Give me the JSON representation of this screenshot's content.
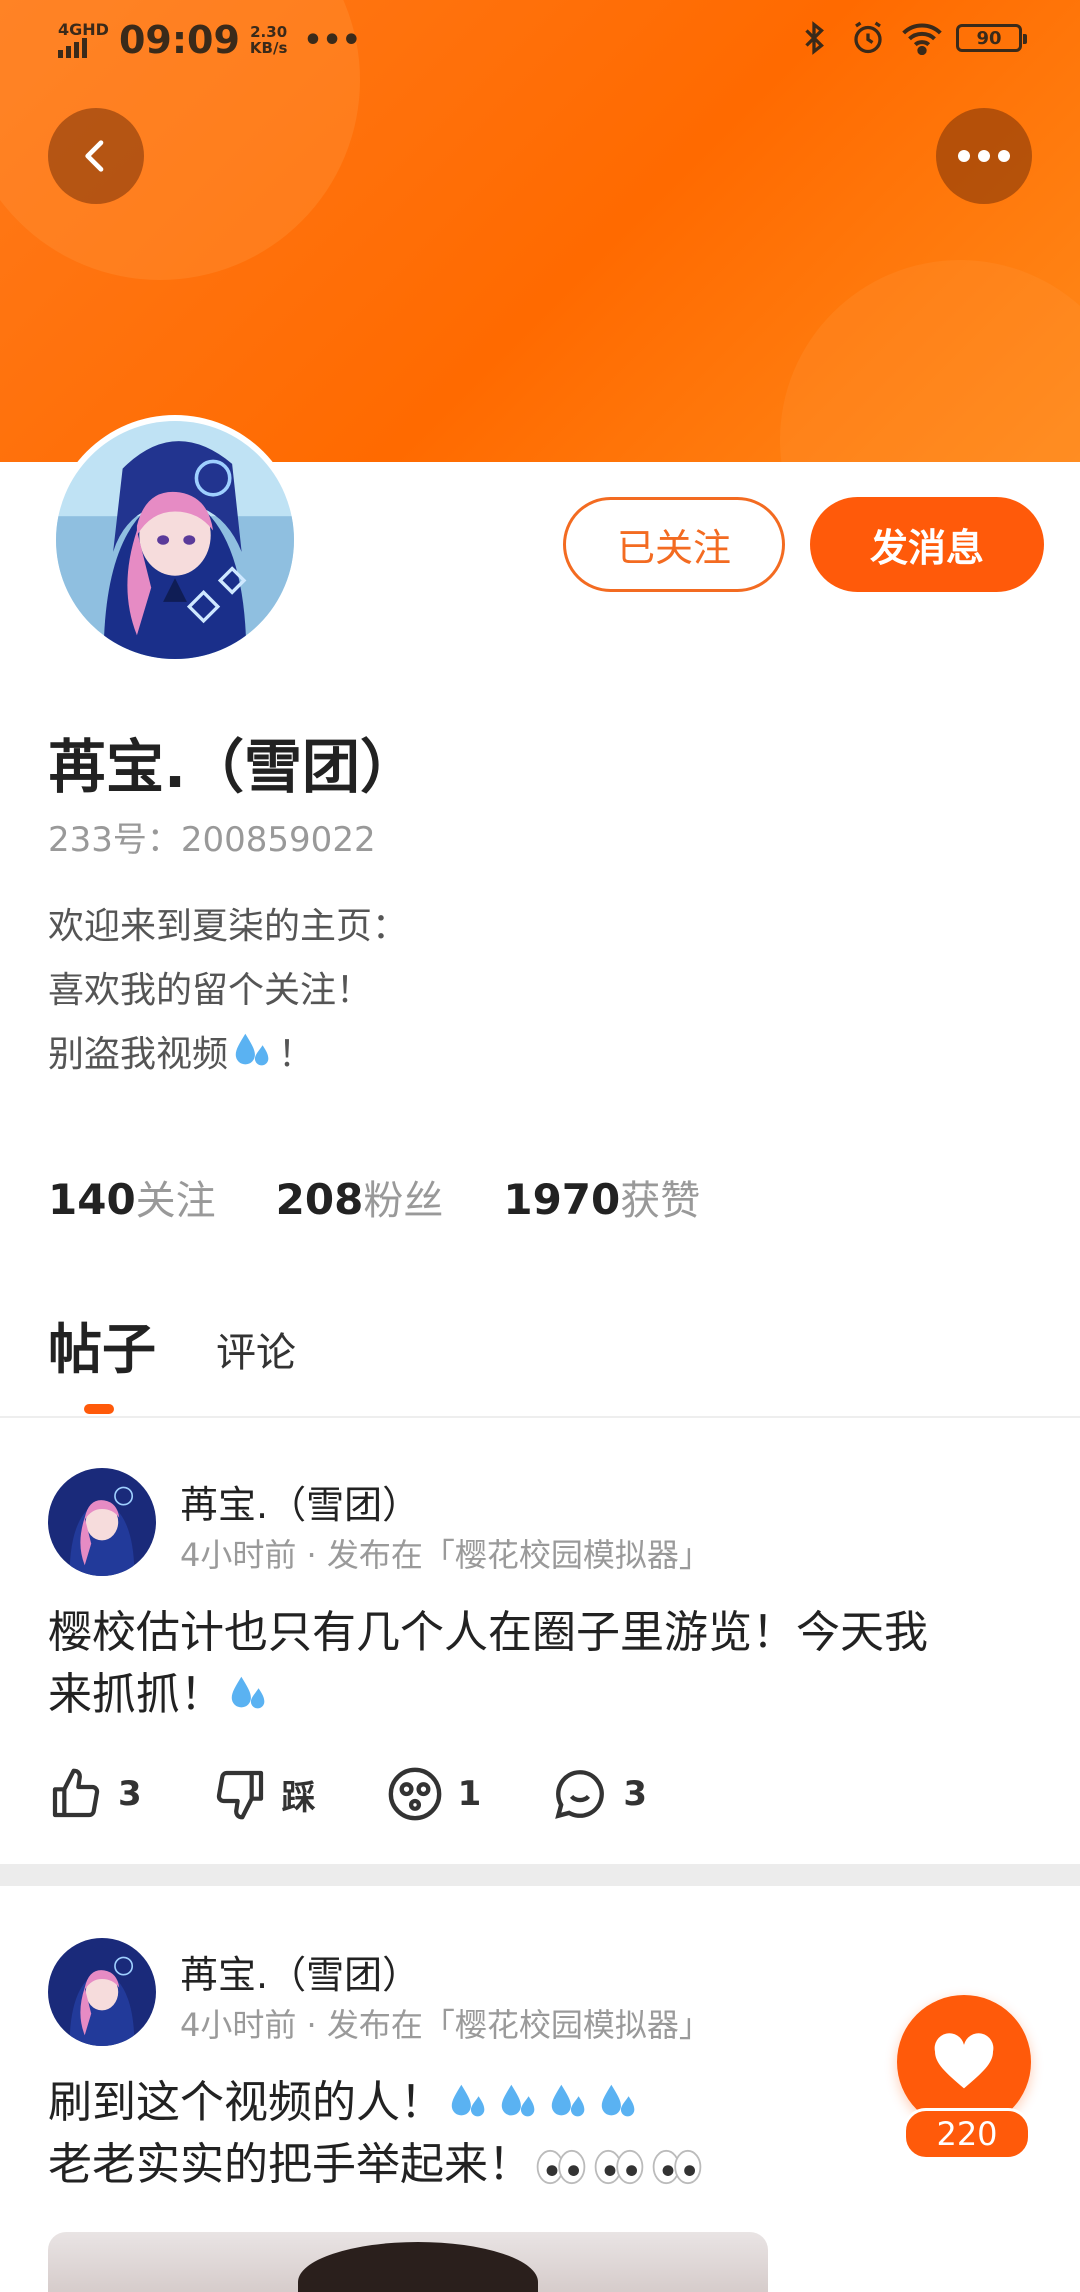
{
  "status_bar": {
    "network": "4GHD",
    "time": "09:09",
    "speed_value": "2.30",
    "speed_unit": "KB/s",
    "more": "•••",
    "battery": "90"
  },
  "header": {
    "back_icon": "chevron-left-icon",
    "more_icon": "more-horizontal-icon"
  },
  "profile": {
    "name": "苒宝.（雪团）",
    "uid": "233号：200859022",
    "bio": [
      "欢迎来到夏柒的主页：",
      "喜欢我的留个关注！",
      "别盗我视频"
    ],
    "bio_tail": "！",
    "follow_button": "已关注",
    "message_button": "发消息",
    "stats": [
      {
        "num": "140",
        "label": "关注"
      },
      {
        "num": "208",
        "label": "粉丝"
      },
      {
        "num": "1970",
        "label": "获赞"
      }
    ]
  },
  "tabs": [
    {
      "label": "帖子",
      "active": true
    },
    {
      "label": "评论",
      "active": false
    }
  ],
  "posts": [
    {
      "author": "苒宝.（雪团）",
      "meta": "4小时前 · 发布在「樱花校园模拟器」",
      "text_line1": "樱校估计也只有几个人在圈子里游览！今天我",
      "text_line2": "来抓抓！",
      "actions": {
        "like": "3",
        "dislike": "踩",
        "emoji": "1",
        "comment": "3"
      }
    },
    {
      "author": "苒宝.（雪团）",
      "meta": "4小时前 · 发布在「樱花校园模拟器」",
      "text_line1": "刷到这个视频的人！",
      "text_line2": "老老实实的把手举起来！"
    }
  ],
  "like_fab": {
    "count": "220"
  },
  "colors": {
    "accent": "#ff5a0a",
    "banner": "#ff6a00"
  }
}
